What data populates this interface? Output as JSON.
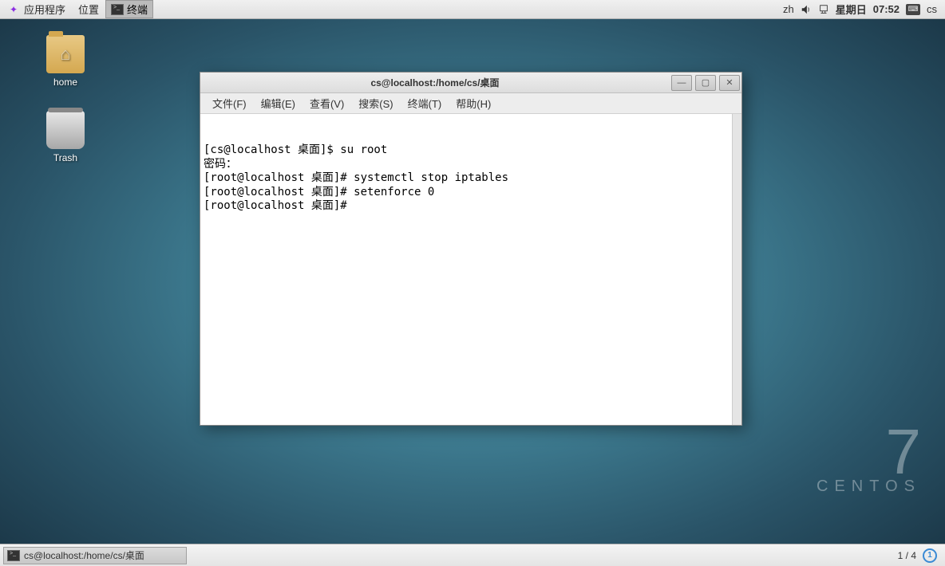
{
  "top_panel": {
    "apps_menu": "应用程序",
    "places_menu": "位置",
    "running_app": "终端",
    "input_method": "zh",
    "clock_day": "星期日",
    "clock_time": "07:52",
    "user": "cs"
  },
  "desktop_icons": {
    "home": "home",
    "trash": "Trash"
  },
  "brand": {
    "version": "7",
    "name": "CENTOS"
  },
  "window": {
    "title": "cs@localhost:/home/cs/桌面",
    "menu": {
      "file": "文件(F)",
      "edit": "编辑(E)",
      "view": "查看(V)",
      "search": "搜索(S)",
      "terminal": "终端(T)",
      "help": "帮助(H)"
    },
    "terminal_lines": [
      "[cs@localhost 桌面]$ su root",
      "密码：",
      "[root@localhost 桌面]# systemctl stop iptables",
      "[root@localhost 桌面]# setenforce 0",
      "[root@localhost 桌面]# "
    ]
  },
  "bottom_panel": {
    "task": "cs@localhost:/home/cs/桌面",
    "workspace": "1 / 4",
    "ws_current": "1"
  }
}
